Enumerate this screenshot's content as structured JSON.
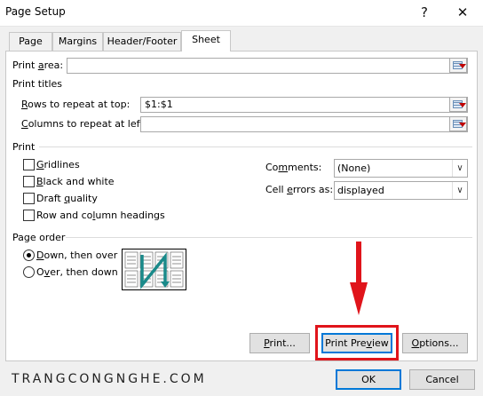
{
  "window": {
    "title": "Page Setup",
    "help": "?",
    "close": "✕"
  },
  "tabs": [
    {
      "label": "Page"
    },
    {
      "label": "Margins"
    },
    {
      "label": "Header/Footer"
    },
    {
      "label": "Sheet"
    }
  ],
  "print_area": {
    "label_pre": "Print ",
    "label_u": "a",
    "label_post": "rea:",
    "value": ""
  },
  "print_titles": {
    "heading": "Print titles",
    "rows": {
      "label_u": "R",
      "label_post": "ows to repeat at top:",
      "value": "$1:$1"
    },
    "cols": {
      "label_u": "C",
      "label_post": "olumns to repeat at left:",
      "value": ""
    }
  },
  "print": {
    "heading": "Print",
    "gridlines": {
      "label_u": "G",
      "label_post": "ridlines",
      "checked": false
    },
    "black_white": {
      "label_u": "B",
      "label_post": "lack and white",
      "checked": false
    },
    "draft": {
      "label_pre": "Draft ",
      "label_u": "q",
      "label_post": "uality",
      "checked": false
    },
    "headings": {
      "label_pre": "Row and co",
      "label_u": "l",
      "label_post": "umn headings",
      "checked": false
    },
    "comments": {
      "label_pre": "Co",
      "label_u": "m",
      "label_post": "ments:",
      "value": "(None)"
    },
    "cell_errors": {
      "label_pre": "Cell ",
      "label_u": "e",
      "label_post": "rrors as:",
      "value": "displayed"
    }
  },
  "page_order": {
    "heading": "Page order",
    "down_over": {
      "label_u": "D",
      "label_post": "own, then over",
      "selected": true
    },
    "over_down": {
      "label_pre": "O",
      "label_u": "v",
      "label_post": "er, then down",
      "selected": false
    }
  },
  "buttons": {
    "print": {
      "label_u": "P",
      "label_post": "rint..."
    },
    "preview": {
      "label_pre": "Print Pre",
      "label_u": "v",
      "label_post": "iew"
    },
    "options": {
      "label_u": "O",
      "label_post": "ptions..."
    },
    "ok": "OK",
    "cancel": "Cancel"
  },
  "watermark": "TRANGCONGNGHE.COM",
  "colors": {
    "annotation_red": "#e0141b",
    "accent_blue": "#0078d7",
    "diagram_teal": "#1a8a8a"
  }
}
